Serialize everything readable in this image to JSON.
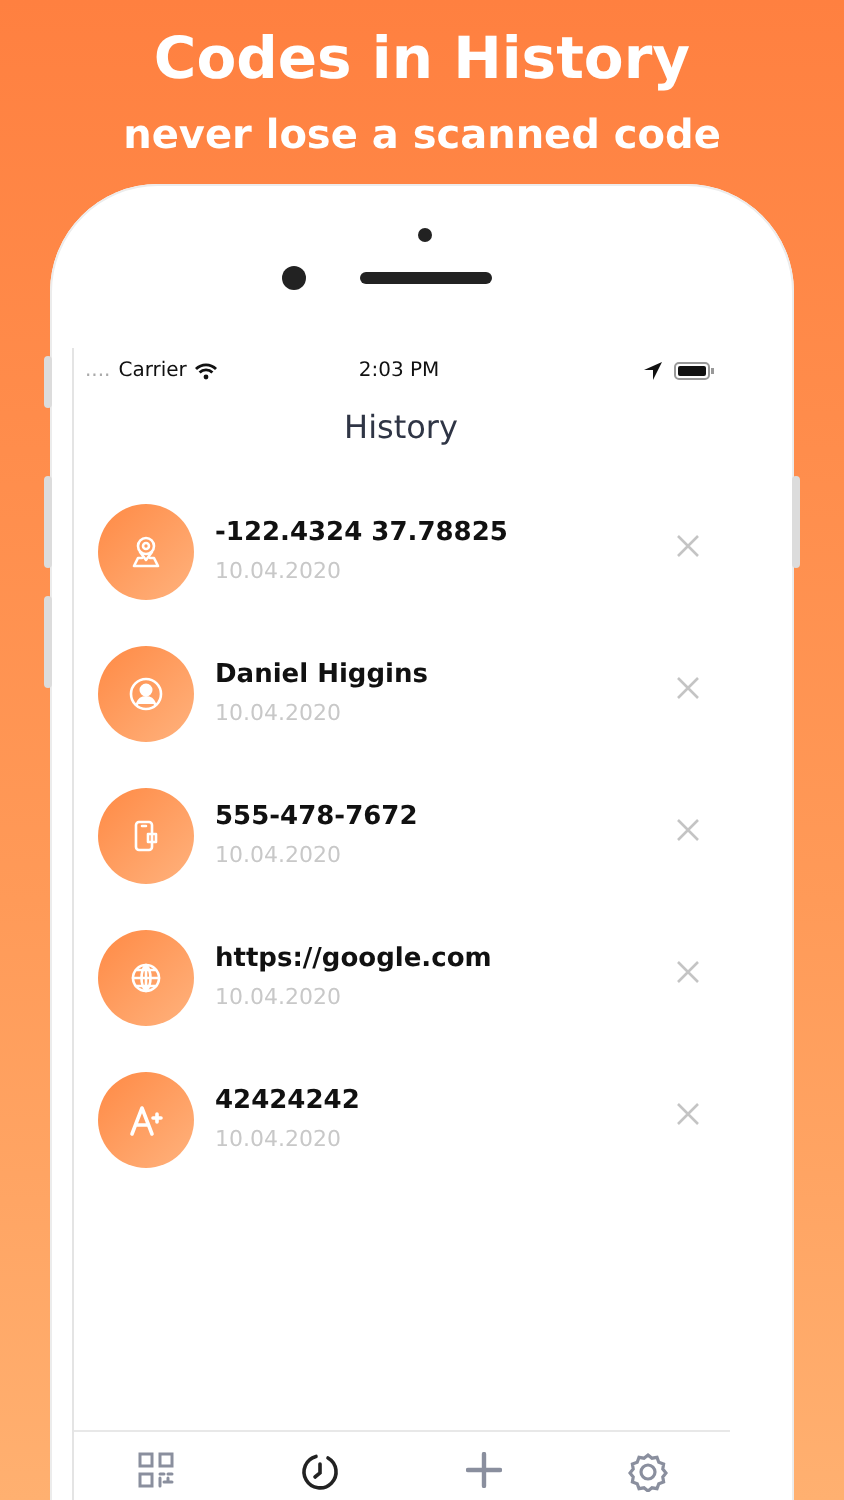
{
  "headline": {
    "title": "Codes in History",
    "subtitle": "never lose a scanned code"
  },
  "status_bar": {
    "signal": "....",
    "carrier": "Carrier",
    "time": "2:03 PM"
  },
  "screen_title": "History",
  "history": [
    {
      "kind": "location",
      "value": "-122.4324 37.78825",
      "date": "10.04.2020"
    },
    {
      "kind": "contact",
      "value": "Daniel Higgins",
      "date": "10.04.2020"
    },
    {
      "kind": "phone",
      "value": "555-478-7672",
      "date": "10.04.2020"
    },
    {
      "kind": "url",
      "value": "https://google.com",
      "date": "10.04.2020"
    },
    {
      "kind": "text",
      "value": "42424242",
      "date": "10.04.2020"
    }
  ],
  "tab_bar": [
    {
      "kind": "scan",
      "selected": false
    },
    {
      "kind": "history",
      "selected": true
    },
    {
      "kind": "create",
      "selected": false
    },
    {
      "kind": "settings",
      "selected": false
    }
  ]
}
